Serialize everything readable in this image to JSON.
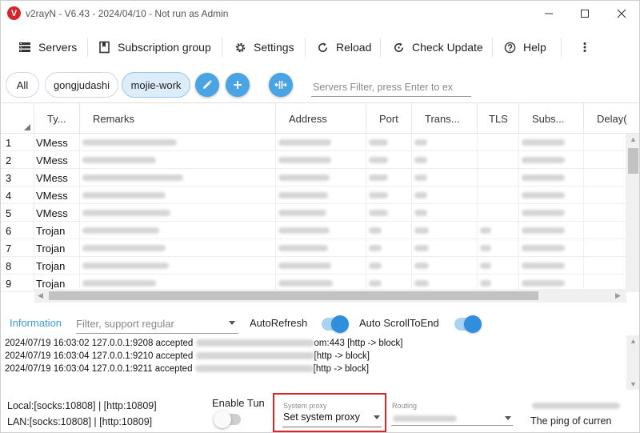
{
  "window": {
    "title": "v2rayN - V6.43 - 2024/04/10 - Not run as Admin",
    "app_icon": "v2rayn-logo-icon",
    "accent": "#d8232a"
  },
  "toolbar": {
    "servers": "Servers",
    "subscription": "Subscription group",
    "settings": "Settings",
    "reload": "Reload",
    "check_update": "Check Update",
    "help": "Help"
  },
  "groups": {
    "chips": [
      "All",
      "gongjudashi",
      "mojie-work"
    ],
    "active": "mojie-work",
    "filter_placeholder": "Servers Filter, press Enter to ex",
    "chip_active_color": "#dcecf8",
    "fab_color": "#4aa3e3"
  },
  "table": {
    "columns": [
      "Ty...",
      "Remarks",
      "Address",
      "Port",
      "Trans...",
      "TLS",
      "Subs...",
      "Delay("
    ],
    "rows": [
      {
        "num": "1",
        "type": "VMess"
      },
      {
        "num": "2",
        "type": "VMess"
      },
      {
        "num": "3",
        "type": "VMess"
      },
      {
        "num": "4",
        "type": "VMess"
      },
      {
        "num": "5",
        "type": "VMess"
      },
      {
        "num": "6",
        "type": "Trojan"
      },
      {
        "num": "7",
        "type": "Trojan"
      },
      {
        "num": "8",
        "type": "Trojan"
      },
      {
        "num": "9",
        "type": "Trojan"
      }
    ]
  },
  "info": {
    "label": "Information",
    "filter_placeholder": "Filter, support regular",
    "auto_refresh": "AutoRefresh",
    "auto_scroll": "Auto ScrollToEnd",
    "auto_refresh_on": true,
    "auto_scroll_on": true,
    "logs": [
      {
        "prefix": "2024/07/19 16:03:02 127.0.0.1:9208 accepted",
        "suffix": "om:443 [http -> block]"
      },
      {
        "prefix": "2024/07/19 16:03:04 127.0.0.1:9210 accepted",
        "suffix": "[http -> block]"
      },
      {
        "prefix": "2024/07/19 16:03:04 127.0.0.1:9211 accepted",
        "suffix": "[http -> block]"
      }
    ]
  },
  "status": {
    "local": "Local:[socks:10808] | [http:10809]",
    "lan": "LAN:[socks:10808] | [http:10809]",
    "enable_tun": "Enable Tun",
    "system_proxy_label": "System proxy",
    "system_proxy_value": "Set system proxy",
    "routing_label": "Routing",
    "ping": "The ping of curren",
    "highlight_color": "#d9262b"
  }
}
